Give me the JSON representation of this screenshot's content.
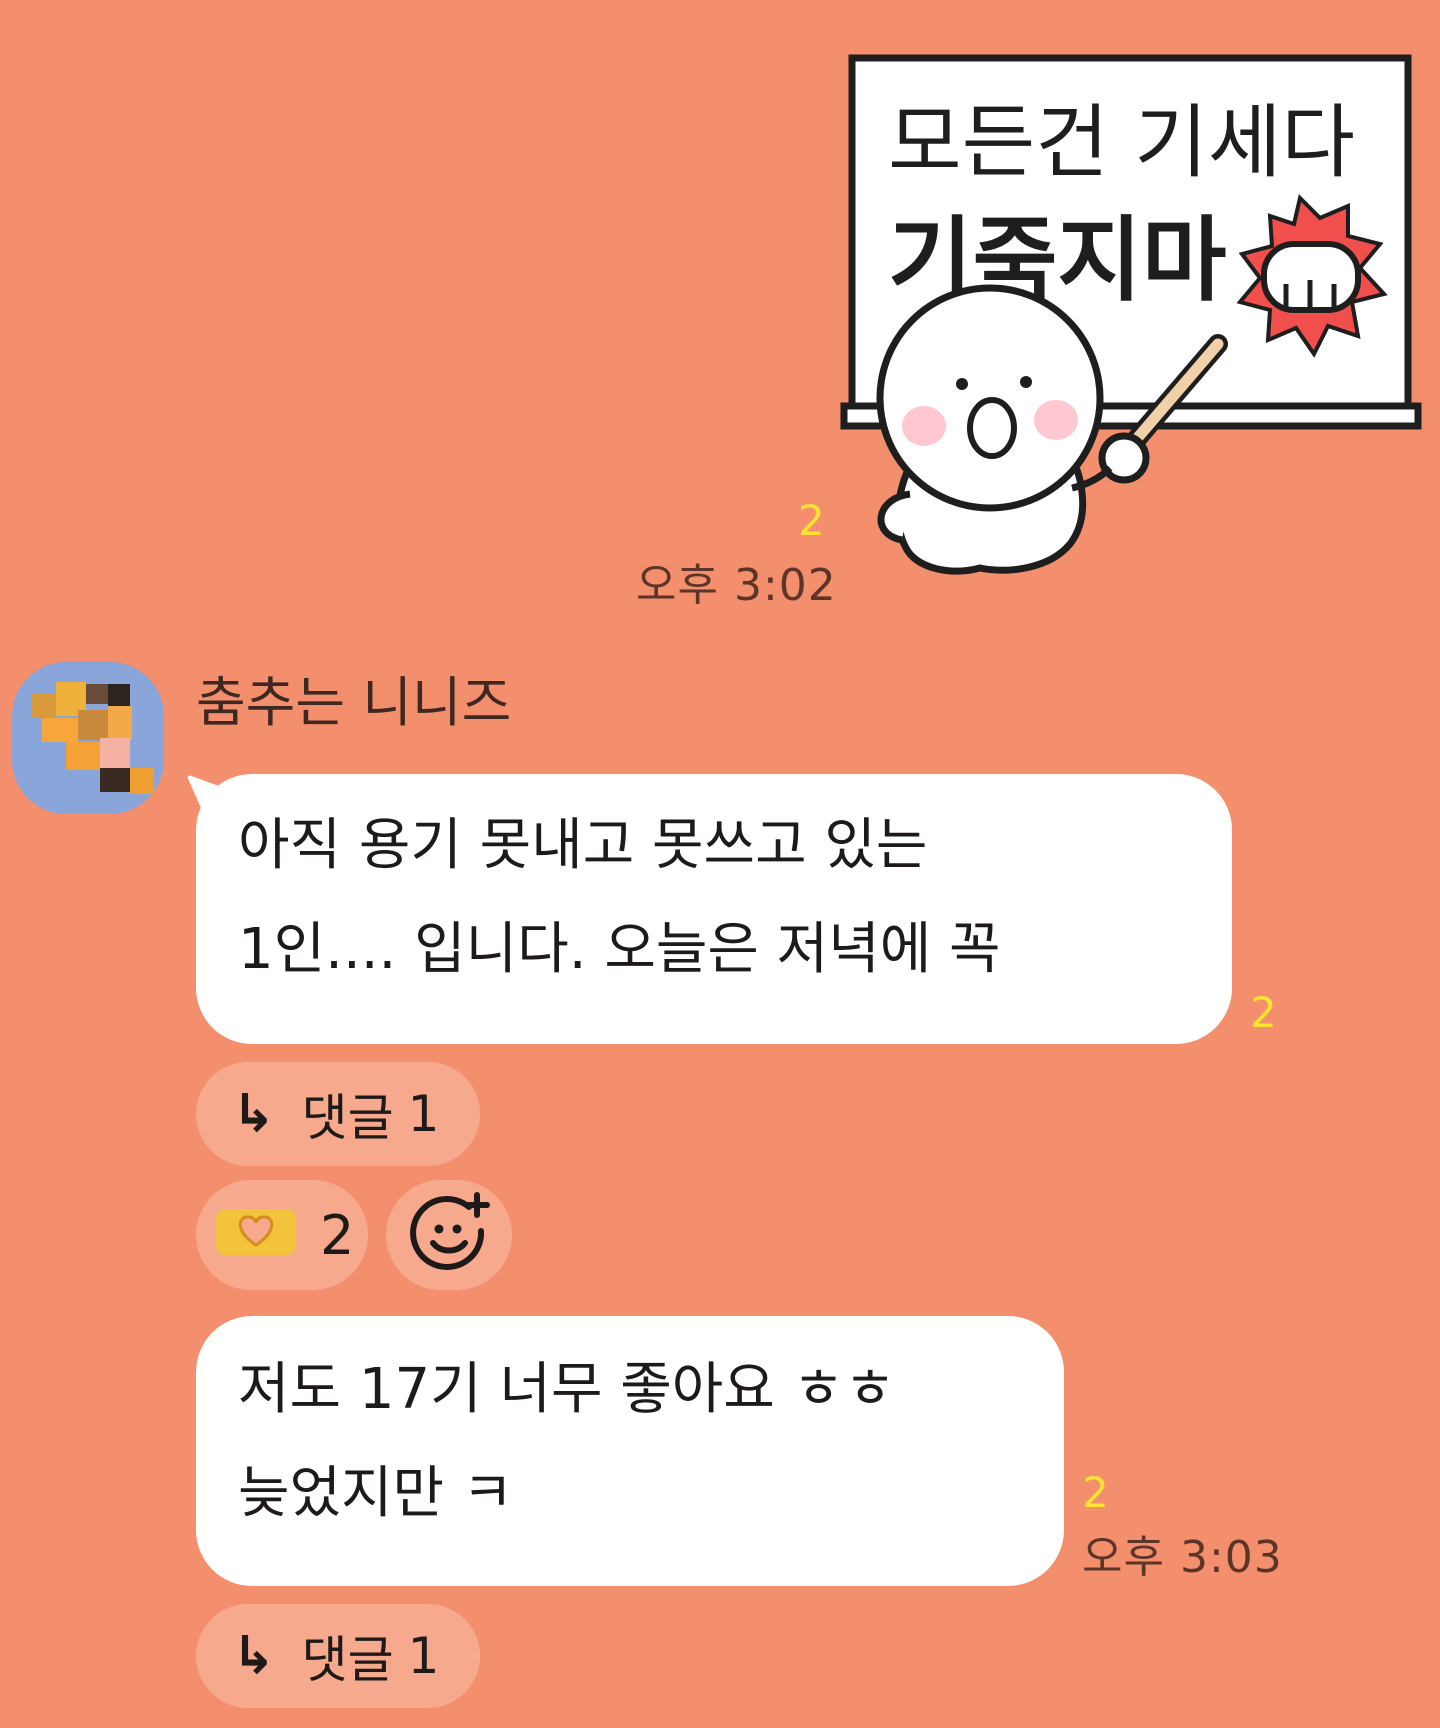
{
  "sticker": {
    "board_line1": "모든건 기세다",
    "board_line2": "기죽지마",
    "unread_count": "2",
    "time": "오후 3:02"
  },
  "sender": {
    "name": "춤추는 니니즈"
  },
  "messages": [
    {
      "lines": [
        "아직 용기 못내고 못쓰고 있는",
        "1인.... 입니다. 오늘은 저녁에 꼭"
      ],
      "unread_count": "2",
      "reply_label": "댓글",
      "reply_count": "1"
    },
    {
      "lines": [
        "저도 17기 너무 좋아요 ㅎㅎ",
        "늦었지만 ㅋ"
      ],
      "unread_count": "2",
      "time": "오후 3:03",
      "reply_label": "댓글",
      "reply_count": "1"
    }
  ],
  "reaction": {
    "icon": "heart-hands-icon",
    "count": "2",
    "add_icon": "add-emoji-icon"
  },
  "colors": {
    "background": "#f48f6d",
    "pill": "#f7a98e",
    "bubble": "#ffffff",
    "unread": "#ffe234",
    "sticker_accent": "#f04f4b"
  }
}
